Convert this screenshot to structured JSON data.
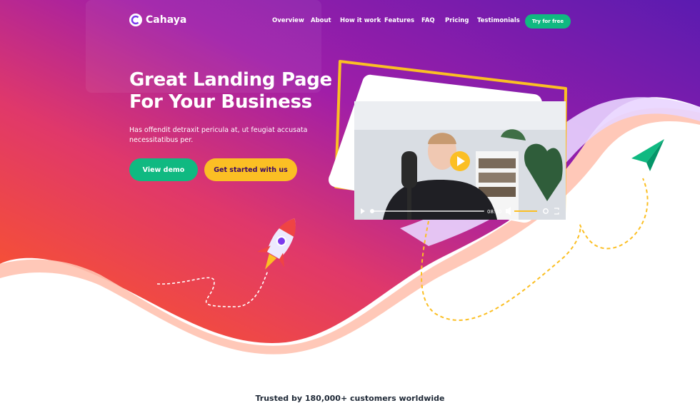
{
  "brand": {
    "name": "Cahaya",
    "logo_icon": "c-logo-icon"
  },
  "nav": {
    "links": [
      "Overview",
      "About",
      "How it work",
      "Features",
      "FAQ",
      "Pricing",
      "Testimonials"
    ],
    "cta": "Try for free"
  },
  "hero": {
    "headline_line1": "Great Landing Page",
    "headline_line2": "For Your Business",
    "subtext_line1": "Has offendit detraxit pericula at, ut feugiat accusata",
    "subtext_line2": "necessitatibus per.",
    "primary_cta": "View demo",
    "secondary_cta": "Get started with us"
  },
  "video": {
    "timestamp": "08:30",
    "play_icon": "play-icon"
  },
  "trusted": {
    "text": "Trusted by 180,000+ customers worldwide"
  },
  "colors": {
    "purple": "#5b21b6",
    "magenta": "#c026d3",
    "orange": "#f97316",
    "green": "#10b981",
    "yellow": "#fbbf24"
  }
}
